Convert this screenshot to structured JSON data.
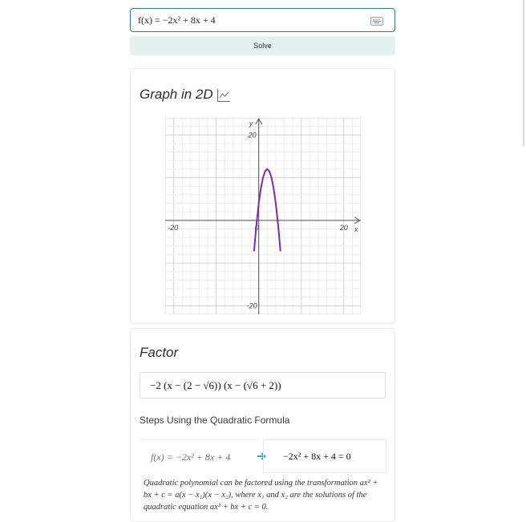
{
  "input": {
    "value": "f(x) = −2x² + 8x + 4",
    "keyboard_icon": "keyboard-icon"
  },
  "solve": {
    "label": "Solve"
  },
  "graph": {
    "title": "Graph in 2D",
    "icon": "line-chart-icon"
  },
  "chart_data": {
    "type": "line",
    "title": "",
    "xlabel": "x",
    "ylabel": "y",
    "xlim": [
      -22,
      24
    ],
    "ylim": [
      -22,
      24
    ],
    "x_ticks": [
      "-20",
      "0",
      "20"
    ],
    "y_ticks": [
      "20",
      "-20"
    ],
    "grid": true,
    "series": [
      {
        "color": "#7a2bb6",
        "function": "-2x^2 + 8x + 4",
        "x": [
          -0.6,
          0,
          0.5,
          1,
          1.5,
          2,
          2.5,
          3,
          3.5,
          4,
          4.6
        ],
        "y": [
          -1.52,
          4,
          7.5,
          10,
          11.5,
          12,
          11.5,
          10,
          7.5,
          4,
          -1.52
        ]
      }
    ]
  },
  "factor": {
    "title": "Factor",
    "result": "−2 (x − (2 − √6)) (x − (√6 + 2))",
    "steps_label": "Steps Using the Quadratic Formula",
    "step_left": "f(x) = −2x² + 8x + 4",
    "step_arrow_icon": "arrow-right-icon",
    "step_right": "−2x² + 8x + 4 = 0",
    "explanation": "Quadratic polynomial can be factored using the transformation ax² + bx + c = a(x − x₁)(x − x₂), where x₁ and x₂ are the solutions of the quadratic equation ax² + bx + c = 0."
  },
  "colors": {
    "accent": "#2f7f7b",
    "button_bg": "#e3f1f1",
    "curve": "#7a2bb6",
    "arrow": "#2bb3ad"
  }
}
